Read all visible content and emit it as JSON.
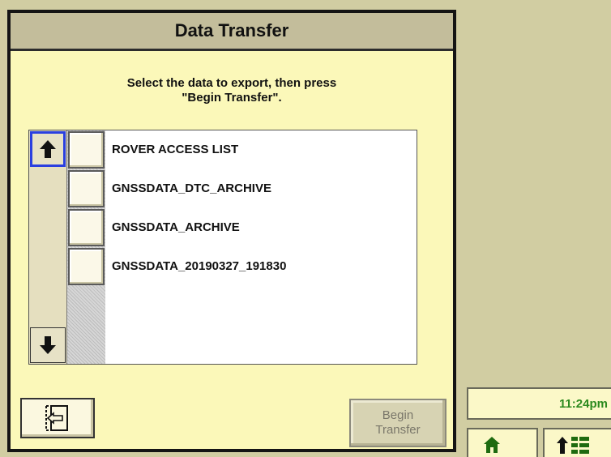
{
  "dialog": {
    "title": "Data Transfer",
    "instructions": "Select the data to export, then press\n\"Begin Transfer\"."
  },
  "list": {
    "items": [
      {
        "label": "ROVER ACCESS LIST",
        "checked": false
      },
      {
        "label": "GNSSDATA_DTC_ARCHIVE",
        "checked": false
      },
      {
        "label": "GNSSDATA_ARCHIVE",
        "checked": false
      },
      {
        "label": "GNSSDATA_20190327_191830",
        "checked": false
      }
    ]
  },
  "buttons": {
    "begin_transfer_label": "Begin\nTransfer"
  },
  "status": {
    "clock": "11:24pm"
  },
  "icons": {
    "scroll_up": "arrow-up-icon",
    "scroll_down": "arrow-down-icon",
    "back": "exit-back-icon",
    "home": "home-icon",
    "menu": "up-arrow-menu-icon"
  },
  "colors": {
    "background": "#d1cda2",
    "dialog_bg": "#fbf8b9",
    "header_bg": "#c3bd9b",
    "focus_border": "#2a3fe0",
    "clock_text": "#2c8a1e"
  }
}
